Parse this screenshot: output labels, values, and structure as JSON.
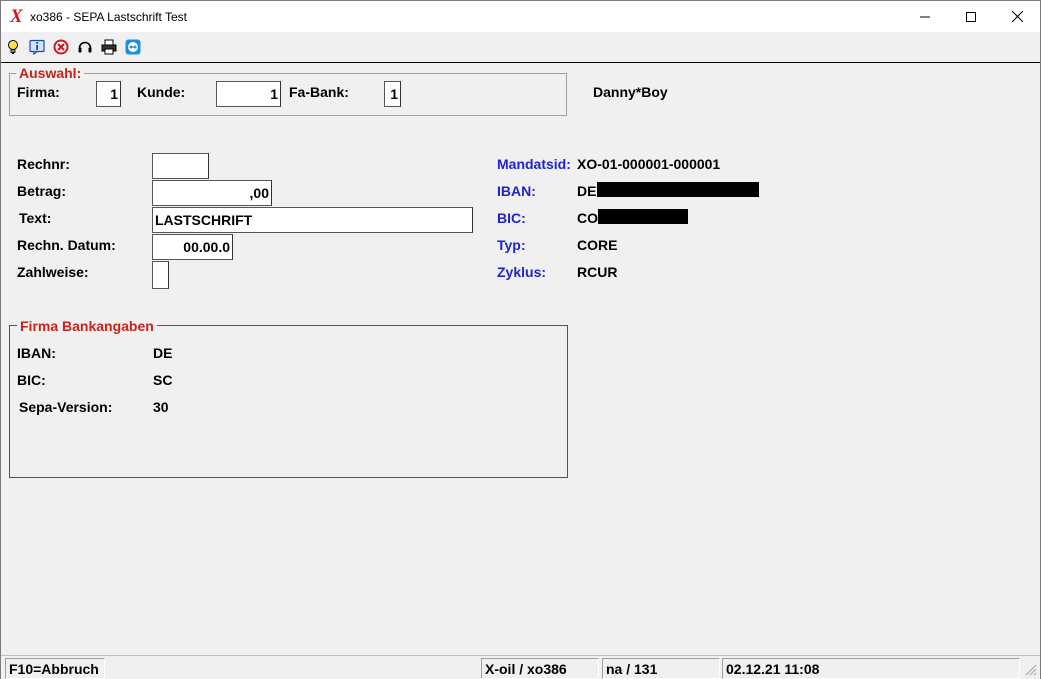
{
  "window": {
    "app_icon": "X",
    "title": "xo386 - SEPA Lastschrift Test"
  },
  "toolbar": {
    "icons": [
      "lightbulb-icon",
      "info-icon",
      "cancel-icon",
      "headset-icon",
      "printer-icon",
      "teamviewer-icon"
    ]
  },
  "auswahl": {
    "legend": "Auswahl:",
    "firma_label": "Firma:",
    "firma_value": "1",
    "kunde_label": "Kunde:",
    "kunde_value": "1",
    "fabank_label": "Fa-Bank:",
    "fabank_value": "1"
  },
  "customer_name": "Danny*Boy",
  "form": {
    "rechnr_label": "Rechnr:",
    "rechnr_value": "",
    "betrag_label": "Betrag:",
    "betrag_value": ",00",
    "text_label": "Text:",
    "text_value": "LASTSCHRIFT",
    "datum_label": "Rechn. Datum:",
    "datum_value": "00.00.0",
    "zahlweise_label": "Zahlweise:",
    "zahlweise_value": ""
  },
  "mandate": {
    "mandatsid_label": "Mandatsid:",
    "mandatsid_value": "XO-01-000001-000001",
    "iban_label": "IBAN:",
    "iban_value": "DE",
    "bic_label": "BIC:",
    "bic_value": "CO",
    "typ_label": "Typ:",
    "typ_value": "CORE",
    "zyklus_label": "Zyklus:",
    "zyklus_value": "RCUR"
  },
  "bank": {
    "legend": "Firma Bankangaben",
    "iban_label": "IBAN:",
    "iban_value": "DE",
    "bic_label": "BIC:",
    "bic_value": "SC",
    "sepa_label": "Sepa-Version:",
    "sepa_value": "30"
  },
  "status": {
    "hint": "F10=Abbruch",
    "app": "X-oil / xo386",
    "user": "na / 131",
    "datetime": "02.12.21 11:08"
  },
  "colors": {
    "accent_red": "#c8241a",
    "label_blue": "#1f24cc",
    "redaction": "#000000"
  }
}
